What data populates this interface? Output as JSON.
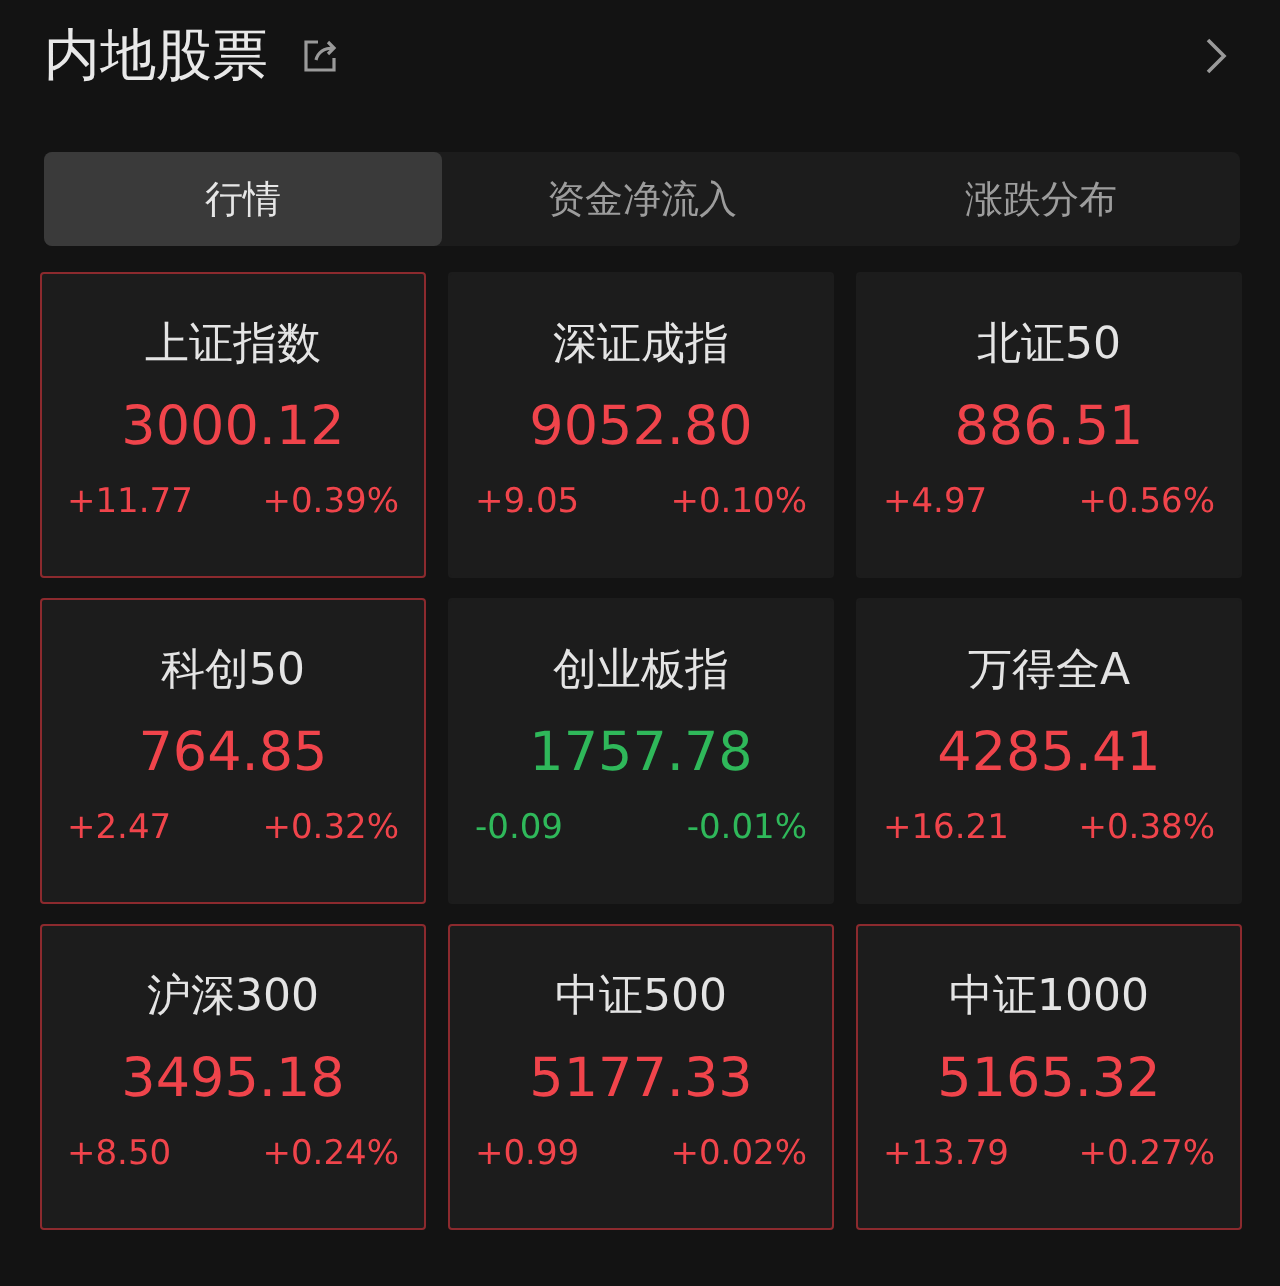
{
  "header": {
    "title": "内地股票"
  },
  "tabs": [
    {
      "label": "行情",
      "selected": true
    },
    {
      "label": "资金净流入",
      "selected": false
    },
    {
      "label": "涨跌分布",
      "selected": false
    }
  ],
  "indices": [
    {
      "name": "上证指数",
      "value": "3000.12",
      "change": "+11.77",
      "percent": "+0.39%",
      "kind": "up",
      "highlighted": true
    },
    {
      "name": "深证成指",
      "value": "9052.80",
      "change": "+9.05",
      "percent": "+0.10%",
      "kind": "up",
      "highlighted": false
    },
    {
      "name": "北证50",
      "value": "886.51",
      "change": "+4.97",
      "percent": "+0.56%",
      "kind": "up",
      "highlighted": false
    },
    {
      "name": "科创50",
      "value": "764.85",
      "change": "+2.47",
      "percent": "+0.32%",
      "kind": "up",
      "highlighted": true
    },
    {
      "name": "创业板指",
      "value": "1757.78",
      "change": "-0.09",
      "percent": "-0.01%",
      "kind": "down",
      "highlighted": false
    },
    {
      "name": "万得全A",
      "value": "4285.41",
      "change": "+16.21",
      "percent": "+0.38%",
      "kind": "up",
      "highlighted": false
    },
    {
      "name": "沪深300",
      "value": "3495.18",
      "change": "+8.50",
      "percent": "+0.24%",
      "kind": "up",
      "highlighted": true
    },
    {
      "name": "中证500",
      "value": "5177.33",
      "change": "+0.99",
      "percent": "+0.02%",
      "kind": "up",
      "highlighted": true
    },
    {
      "name": "中证1000",
      "value": "5165.32",
      "change": "+13.79",
      "percent": "+0.27%",
      "kind": "up",
      "highlighted": true
    }
  ]
}
